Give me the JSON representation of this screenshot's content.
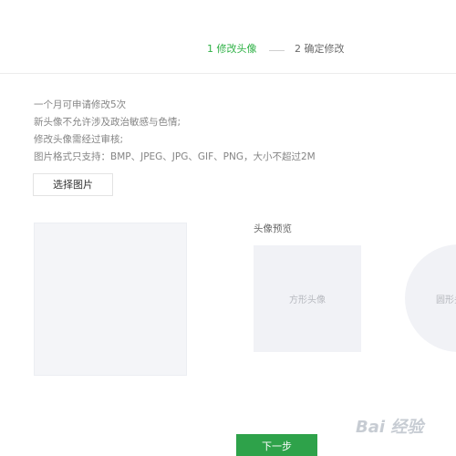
{
  "stepper": {
    "step1": "1 修改头像",
    "step2": "2 确定修改"
  },
  "rules": [
    "一个月可申请修改5次",
    "新头像不允许涉及政治敏感与色情;",
    "修改头像需经过审核;",
    "图片格式只支持：BMP、JPEG、JPG、GIF、PNG，大小不超过2M"
  ],
  "buttons": {
    "choose_image": "选择图片",
    "next_step": "下一步"
  },
  "preview": {
    "title": "头像预览",
    "square_label": "方形头像",
    "circle_label": "圆形头像"
  },
  "colors": {
    "accent": "#2fb146",
    "button_green": "#2ea24a",
    "placeholder_bg": "#f1f2f6"
  },
  "watermark": {
    "text": "Bai 经验"
  }
}
